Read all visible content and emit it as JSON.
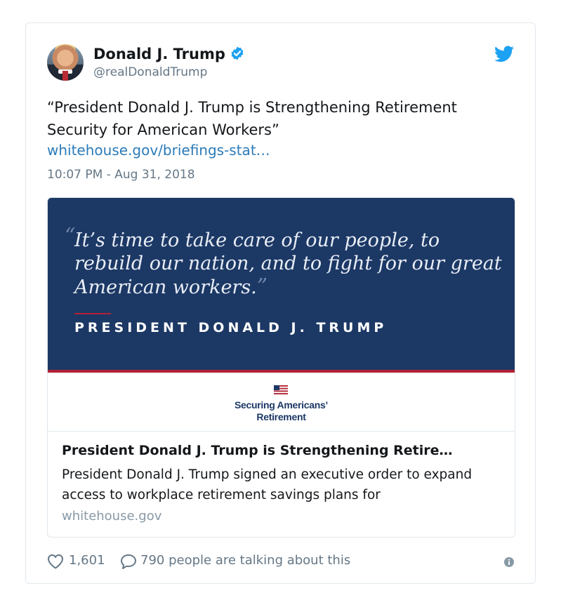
{
  "user": {
    "name": "Donald J. Trump",
    "handle": "@realDonaldTrump"
  },
  "tweet": {
    "text": "“President Donald J. Trump is Strengthening Retirement Security for American Workers”",
    "link": "whitehouse.gov/briefings-stat…",
    "time": "10:07 PM - Aug 31, 2018"
  },
  "media": {
    "quote": "It’s time to take care of our people, to rebuild our nation, and to fight for our great American workers.",
    "attribution": "PRESIDENT DONALD J. TRUMP",
    "logo_line1": "Securing Americans’",
    "logo_line2": "Retirement"
  },
  "card": {
    "title": "President Donald J. Trump is Strengthening Retire…",
    "description": "President Donald J. Trump signed an executive order to expand access to workplace retirement savings plans for",
    "domain": "whitehouse.gov"
  },
  "footer": {
    "likes": "1,601",
    "talking": "790 people are talking about this"
  },
  "colors": {
    "twitter_blue": "#1da1f2",
    "banner_navy": "#1c3865",
    "accent_red": "#b22234",
    "link": "#2b7bb9"
  },
  "icons": [
    "verified-badge-icon",
    "twitter-bird-icon",
    "heart-icon",
    "reply-bubble-icon",
    "info-icon",
    "us-flag-icon"
  ]
}
